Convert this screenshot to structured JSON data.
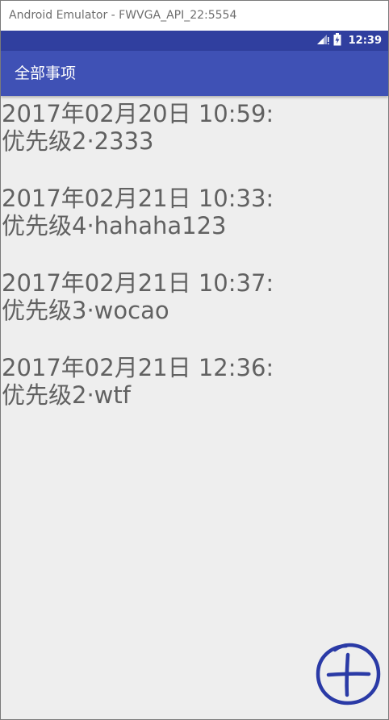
{
  "window": {
    "title": "Android Emulator - FWVGA_API_22:5554"
  },
  "status_bar": {
    "time": "12:39",
    "icons": [
      "signal-icon",
      "battery-icon"
    ],
    "color": "#303f9f"
  },
  "app_bar": {
    "title": "全部事项",
    "color": "#3f51b5"
  },
  "items": [
    {
      "line1": "2017年02月20日 10:59:",
      "line2": "优先级2·2333"
    },
    {
      "line1": "2017年02月21日 10:33:",
      "line2": "优先级4·hahaha123"
    },
    {
      "line1": "2017年02月21日 10:37:",
      "line2": "优先级3·wocao"
    },
    {
      "line1": "2017年02月21日 12:36:",
      "line2": "优先级2·wtf"
    }
  ],
  "fab": {
    "icon": "add-circle-icon",
    "color": "#2a3aa6"
  }
}
